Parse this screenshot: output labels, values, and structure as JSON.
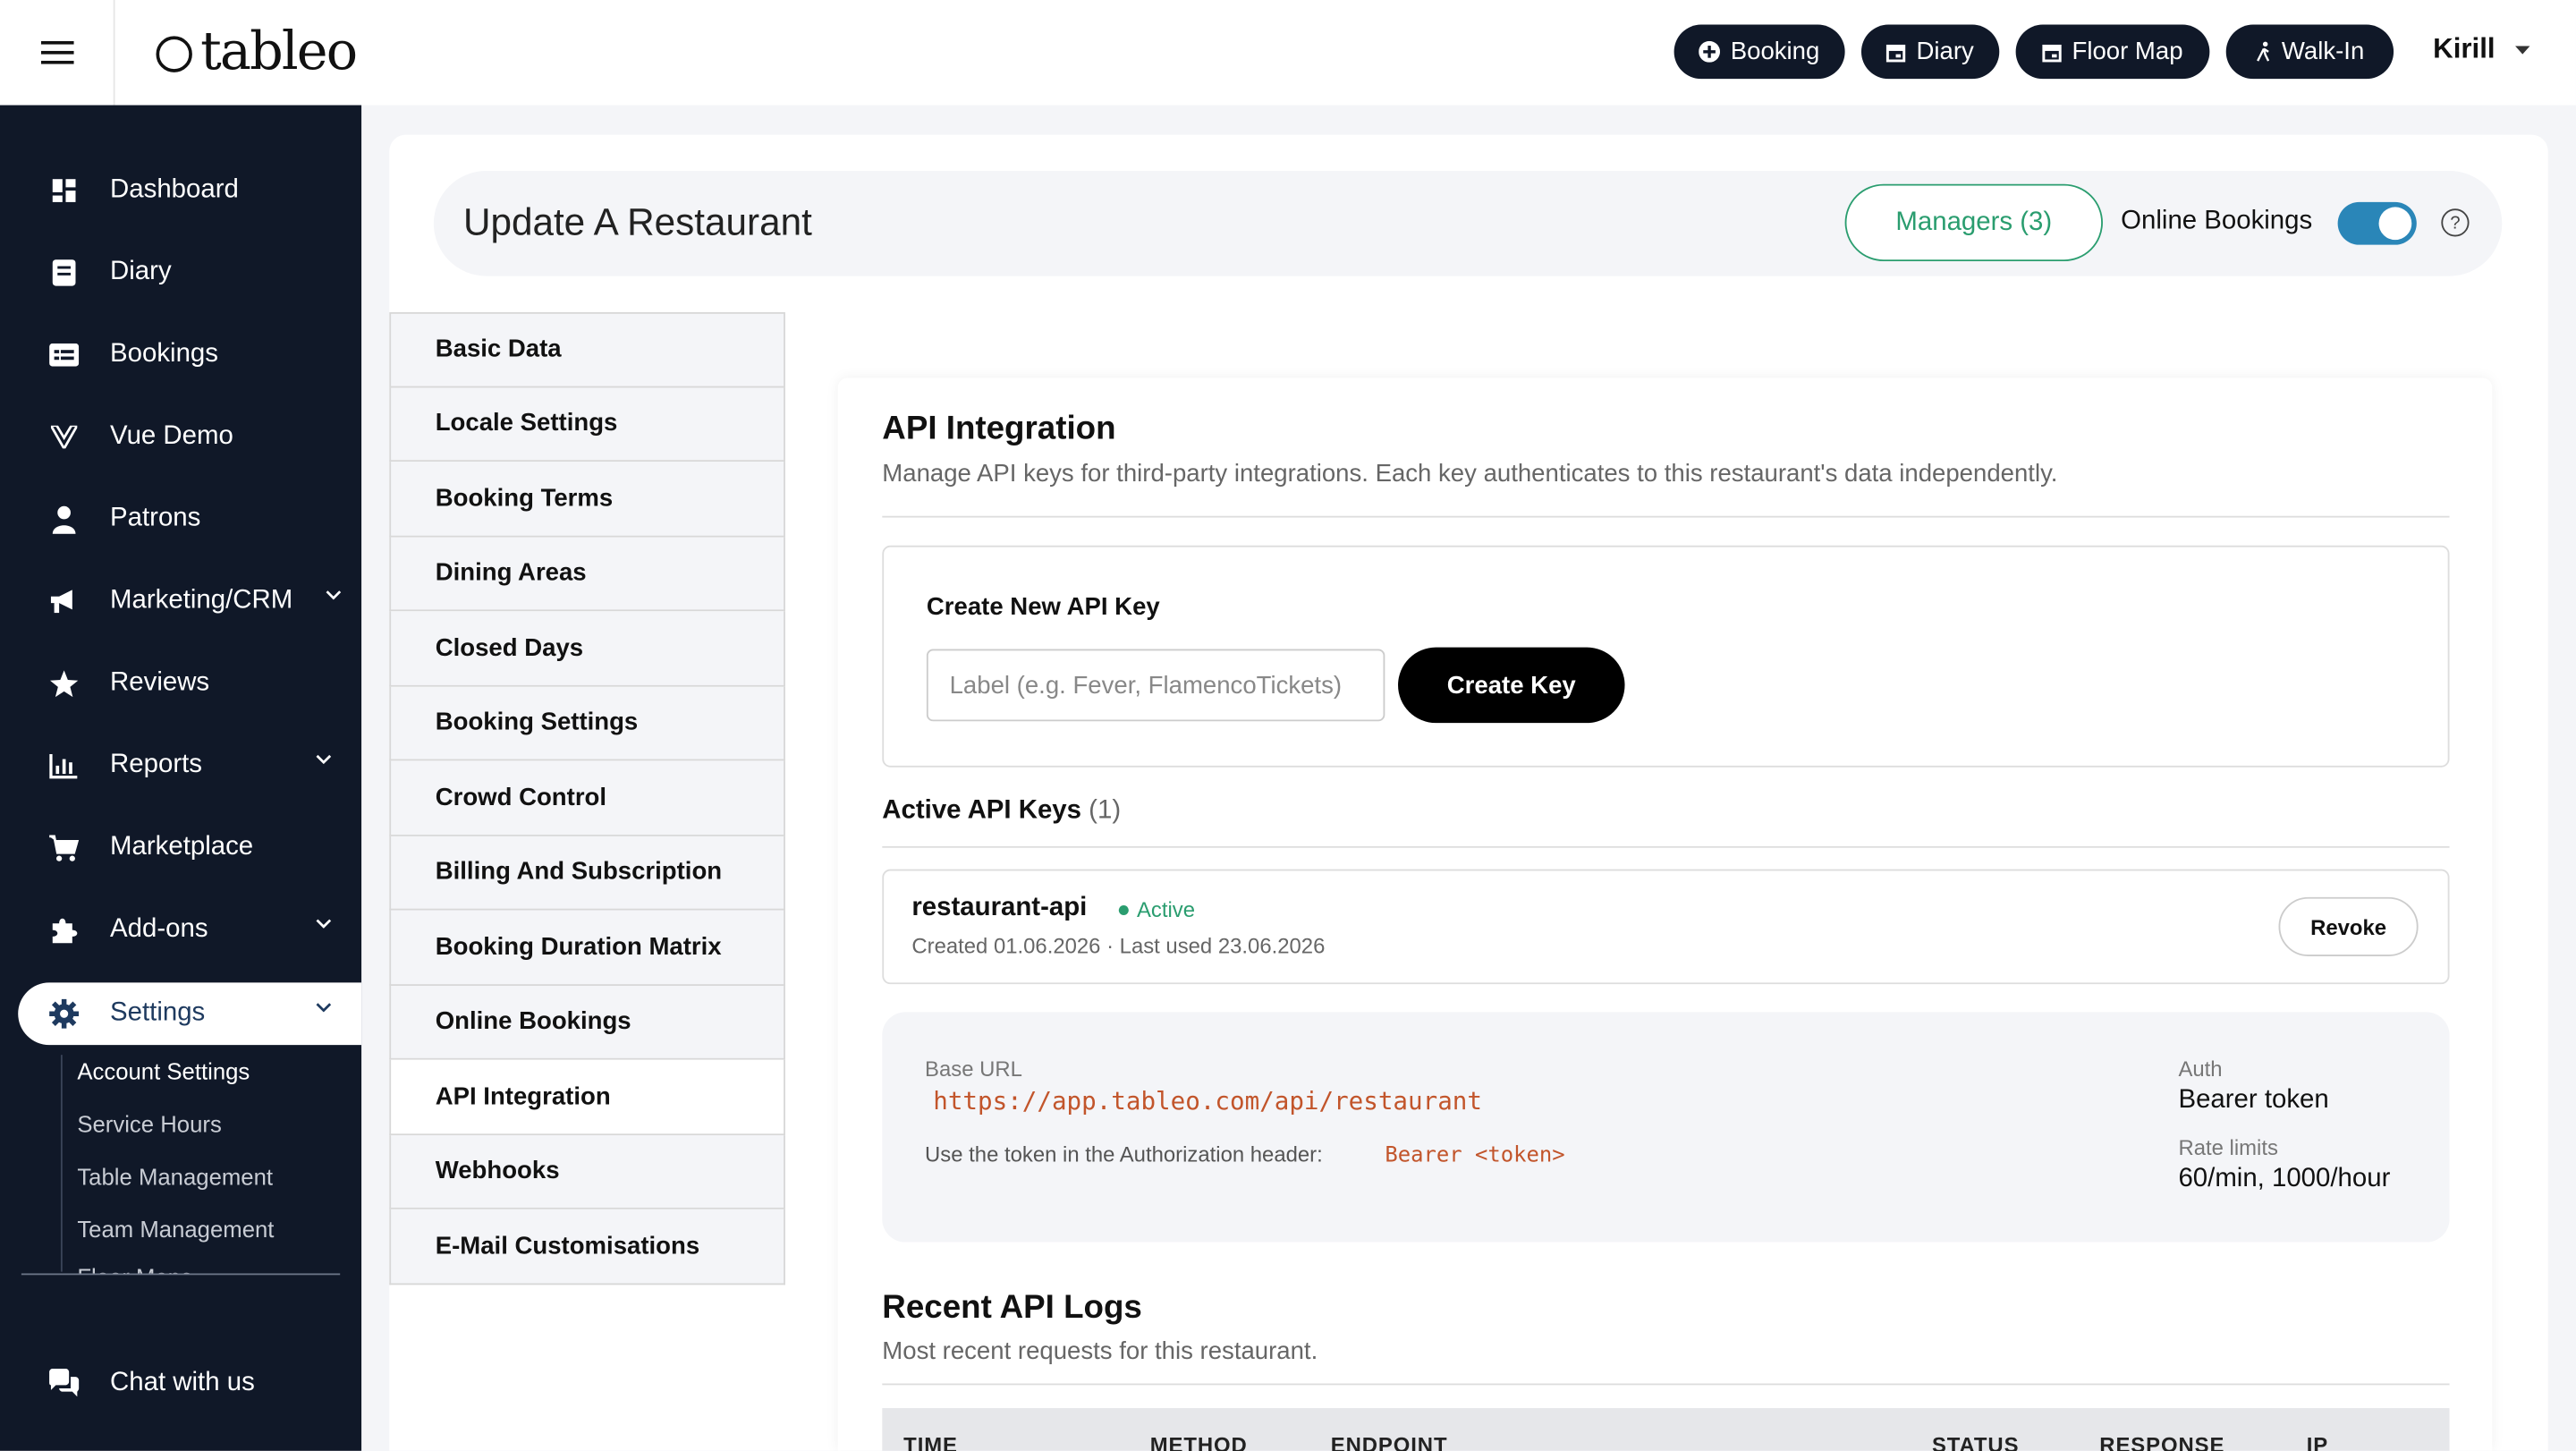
{
  "app": {
    "logo": "tableo",
    "user": "Kirill"
  },
  "topbar": {
    "buttons": [
      {
        "label": "Booking",
        "icon": "plus-circle-icon"
      },
      {
        "label": "Diary",
        "icon": "calendar-icon"
      },
      {
        "label": "Floor Map",
        "icon": "calendar-icon"
      },
      {
        "label": "Walk-In",
        "icon": "walk-icon"
      }
    ]
  },
  "sidebar": {
    "items": [
      {
        "label": "Dashboard"
      },
      {
        "label": "Diary"
      },
      {
        "label": "Bookings"
      },
      {
        "label": "Vue Demo"
      },
      {
        "label": "Patrons"
      },
      {
        "label": "Marketing/CRM"
      },
      {
        "label": "Reviews"
      },
      {
        "label": "Reports"
      },
      {
        "label": "Marketplace"
      },
      {
        "label": "Add-ons"
      },
      {
        "label": "Settings"
      }
    ],
    "settings_sub": [
      "Account Settings",
      "Service Hours",
      "Table Management",
      "Team Management",
      "Floor Maps"
    ],
    "chat": "Chat with us"
  },
  "header": {
    "title": "Update A Restaurant",
    "managers": "Managers (3)",
    "online_bookings": "Online Bookings",
    "online_bookings_enabled": true,
    "help": "?"
  },
  "tabs": [
    "Basic Data",
    "Locale Settings",
    "Booking Terms",
    "Dining Areas",
    "Closed Days",
    "Booking Settings",
    "Crowd Control",
    "Billing And Subscription",
    "Booking Duration Matrix",
    "Online Bookings",
    "API Integration",
    "Webhooks",
    "E-Mail Customisations"
  ],
  "active_tab": "API Integration",
  "api": {
    "title": "API Integration",
    "description": "Manage API keys for third-party integrations. Each key authenticates to this restaurant's data independently.",
    "create_label": "Create New API Key",
    "input_placeholder": "Label (e.g. Fever, FlamencoTickets)",
    "create_button": "Create Key",
    "active_title": "Active API Keys",
    "active_count": "(1)",
    "key": {
      "name": "restaurant-api",
      "status": "Active",
      "meta": "Created 01.06.2026 · Last used 23.06.2026",
      "revoke": "Revoke"
    },
    "base_url_label": "Base URL",
    "base_url": "https://app.tableo.com/api/restaurant",
    "token_hint": "Use the token in the Authorization header:",
    "token_code": "Bearer <token>",
    "auth_label": "Auth",
    "auth_value": "Bearer token",
    "rate_label": "Rate limits",
    "rate_value": "60/min, 1000/hour"
  },
  "logs": {
    "title": "Recent API Logs",
    "description": "Most recent requests for this restaurant.",
    "columns": [
      "TIME",
      "METHOD",
      "ENDPOINT",
      "STATUS",
      "RESPONSE",
      "IP"
    ]
  },
  "colors": {
    "navy": "#101828",
    "green": "#2a9d6f",
    "toggle": "#2a86b8",
    "code": "#c2552b"
  }
}
